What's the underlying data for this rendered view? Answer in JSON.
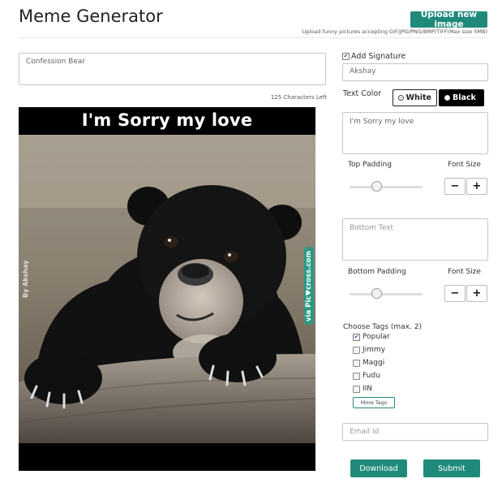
{
  "header": {
    "title": "Meme Generator",
    "upload_label": "Upload new image",
    "upload_hint": "Upload funny pictures accepting GIF/JPG/PNG/BMP/TIFF(Max size 5MB)"
  },
  "editor": {
    "caption_value": "Confession Bear",
    "chars_left": "125 Characters Left"
  },
  "meme": {
    "top_text": "I'm Sorry my love",
    "signature": "By Akshay",
    "watermark": "via Pic♥cross.com"
  },
  "signature": {
    "label": "Add Signature",
    "checked": true,
    "value": "Akshay"
  },
  "text_color": {
    "label": "Text Color",
    "options": [
      "White",
      "Black"
    ],
    "selected": "White"
  },
  "top": {
    "value": "I'm Sorry my love",
    "padding_label": "Top Padding",
    "font_size_label": "Font Size"
  },
  "bottom": {
    "placeholder": "Bottom Text",
    "padding_label": "Bottom Padding",
    "font_size_label": "Font Size"
  },
  "stepper": {
    "minus": "−",
    "plus": "+"
  },
  "tags": {
    "label": "Choose Tags (max. 2)",
    "items": [
      {
        "label": "Popular",
        "checked": true
      },
      {
        "label": "Jimmy",
        "checked": false
      },
      {
        "label": "Maggi",
        "checked": false
      },
      {
        "label": "Fudu",
        "checked": false
      },
      {
        "label": "IIN",
        "checked": false
      }
    ],
    "more_label": "More Tags"
  },
  "email": {
    "placeholder": "Email Id"
  },
  "actions": {
    "download": "Download",
    "submit": "Submit"
  },
  "colors": {
    "accent": "#1f8a7a"
  }
}
